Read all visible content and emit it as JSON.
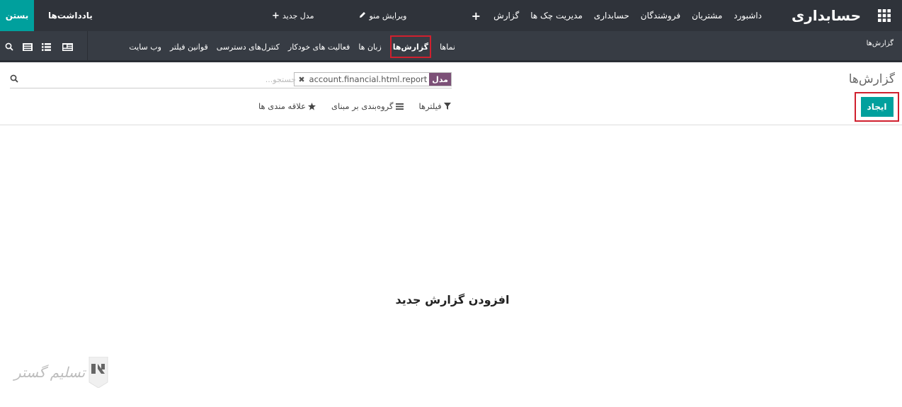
{
  "topbar": {
    "brand": "حسابداری",
    "menu": [
      "داشبورد",
      "مشتریان",
      "فروشندگان",
      "حسابداری",
      "مدیریت چک ها",
      "گزارش"
    ],
    "studio_actions": {
      "edit_menu": "ویرایش منو",
      "new_model": "مدل جدید"
    },
    "notes_label": "یادداشت‌ها",
    "close_label": "بستن"
  },
  "subbar": {
    "title": "گزارش‌ها",
    "items": [
      "نماها",
      "گزارش‌ها",
      "زبان ها",
      "فعالیت های خودکار",
      "کنترل‌های دسترسی",
      "قوانین فیلتر",
      "وب سایت"
    ],
    "active_index": 1
  },
  "control_panel": {
    "title": "گزارش‌ها",
    "create_label": "ایجاد",
    "search": {
      "facet_label": "مدل",
      "facet_value": "account.financial.html.report",
      "placeholder": "جستجو..."
    },
    "filters_label": "فیلترها",
    "group_by_label": "گروه‌بندی بر مبنای",
    "favorites_label": "علاقه مندی ها"
  },
  "empty_state": {
    "message": "افزودن گزارش جدید"
  },
  "watermark": {
    "text": "تسلیم گستر"
  },
  "colors": {
    "navbar": "#2f333a",
    "subbar": "#373c44",
    "accent": "#00a09d",
    "facet": "#7c5077",
    "highlight": "#d0202e"
  }
}
